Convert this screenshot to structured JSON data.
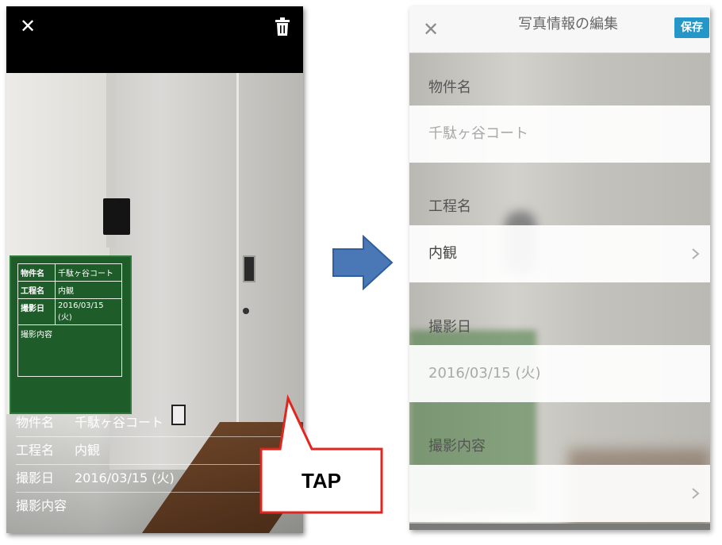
{
  "left_screen": {
    "close_glyph": "✕",
    "board": {
      "rows": [
        {
          "key": "物件名",
          "value": "千駄ヶ谷コート"
        },
        {
          "key": "工程名",
          "value": "内観"
        },
        {
          "key": "撮影日",
          "value": "2016/03/15 (火)"
        },
        {
          "key": "撮影内容",
          "value": ""
        }
      ]
    },
    "info": {
      "rows": [
        {
          "key": "物件名",
          "value": "千駄ヶ谷コート"
        },
        {
          "key": "工程名",
          "value": "内観"
        },
        {
          "key": "撮影日",
          "value": "2016/03/15 (火)"
        },
        {
          "key": "撮影内容",
          "value": ""
        }
      ]
    }
  },
  "callout": {
    "label": "TAP",
    "border_color": "#e0261f"
  },
  "arrow": {
    "color": "#4a78b7"
  },
  "right_screen": {
    "close_glyph": "✕",
    "title": "写真情報の編集",
    "save_label": "保存",
    "save_color": "#2596c8",
    "sections": [
      {
        "label": "物件名",
        "value": "千駄ヶ谷コート",
        "style": "placeholder",
        "chevron": false
      },
      {
        "label": "工程名",
        "value": "内観",
        "style": "value",
        "chevron": true
      },
      {
        "label": "撮影日",
        "value": "2016/03/15 (火)",
        "style": "placeholder",
        "chevron": false
      },
      {
        "label": "撮影内容",
        "value": "",
        "style": "value",
        "chevron": true
      }
    ]
  }
}
